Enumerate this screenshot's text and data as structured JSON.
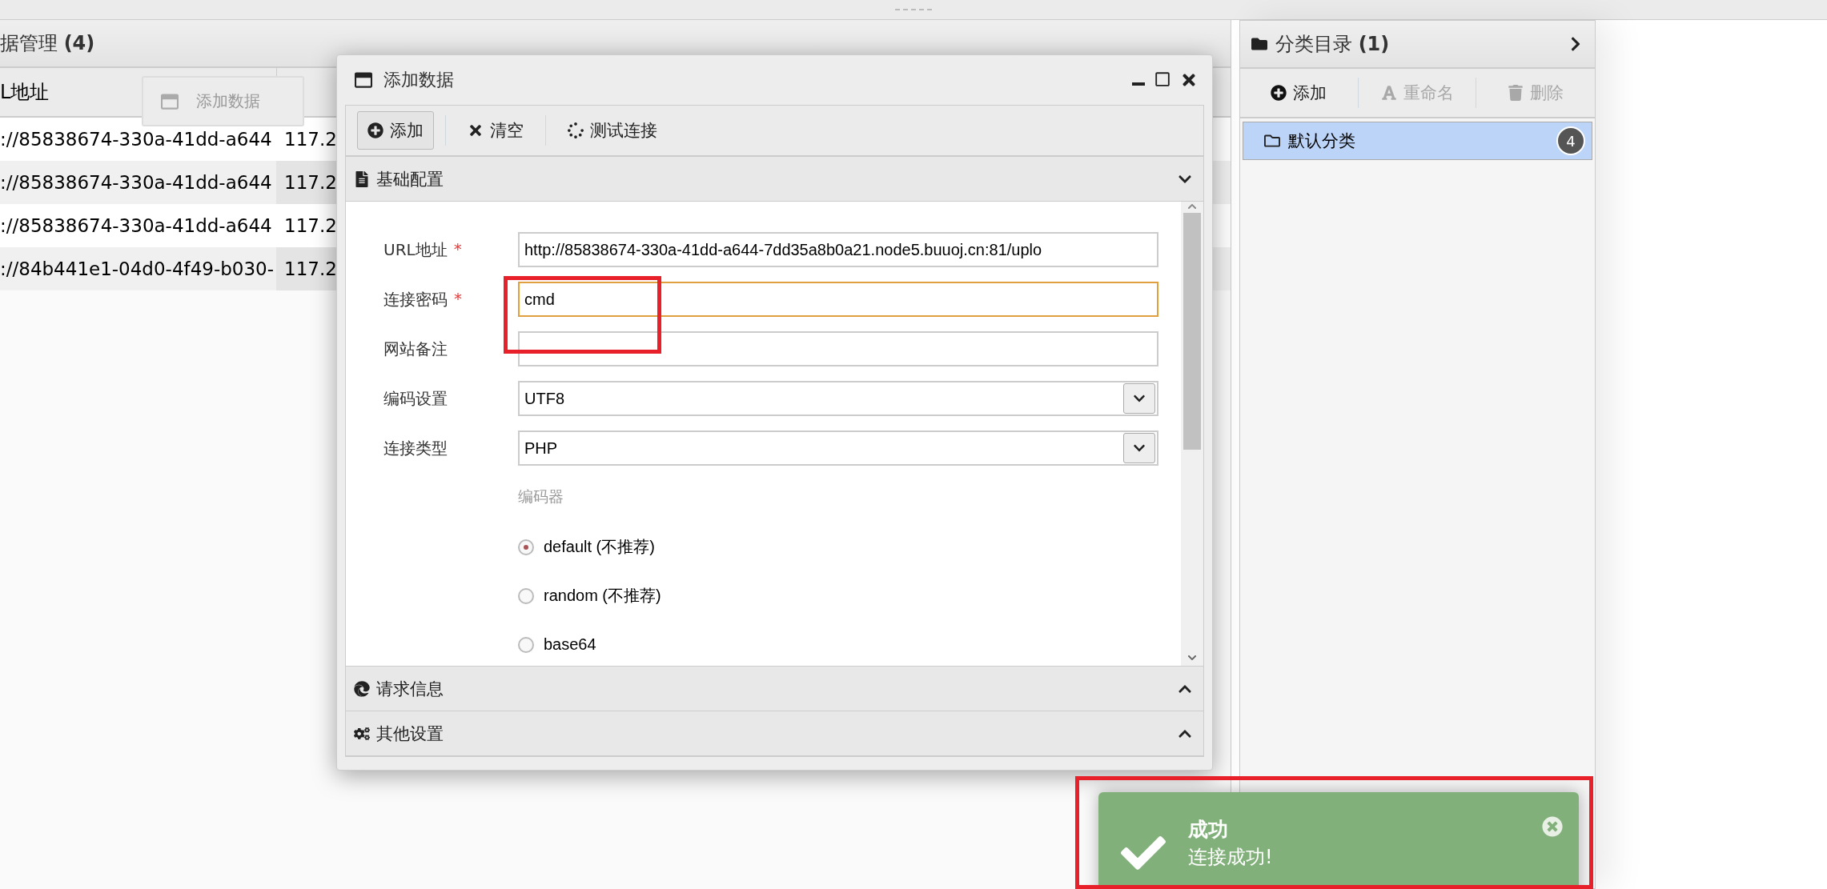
{
  "left_panel": {
    "title": "据管理 **(4)**",
    "column_1": "L地址",
    "rows": [
      {
        "url": "://85838674-330a-41dd-a644",
        "ip": "117.2"
      },
      {
        "url": "://85838674-330a-41dd-a644",
        "ip": "117.2"
      },
      {
        "url": "://85838674-330a-41dd-a644",
        "ip": "117.2"
      },
      {
        "url": "://84b441e1-04d0-4f49-b030-",
        "ip": "117.2"
      }
    ]
  },
  "drag_ghost": {
    "title": "添加数据"
  },
  "dialog": {
    "title": "添加数据",
    "toolbar": [
      {
        "kind": "add",
        "label": "添加"
      },
      {
        "kind": "clear",
        "label": "清空"
      },
      {
        "kind": "test",
        "label": "测试连接"
      }
    ],
    "sections": [
      {
        "kind": "basic",
        "title": "基础配置",
        "expanded": true
      },
      {
        "kind": "request",
        "title": "请求信息",
        "expanded": false
      },
      {
        "kind": "other",
        "title": "其他设置",
        "expanded": false
      }
    ],
    "fields": [
      {
        "kind": "text",
        "label": "URL地址",
        "required_mark": "*",
        "value": "http://85838674-330a-41dd-a644-7dd35a8b0a21.node5.buuoj.cn:81/uplo"
      },
      {
        "kind": "text",
        "label": "连接密码",
        "required_mark": "*",
        "value": "cmd",
        "focused": true
      },
      {
        "kind": "text",
        "label": "网站备注"
      },
      {
        "kind": "select",
        "label": "编码设置",
        "value": "UTF8"
      },
      {
        "kind": "select",
        "label": "连接类型",
        "value": "PHP"
      }
    ],
    "encoder": {
      "label": "编码器",
      "options": [
        {
          "label": "default (不推荐)",
          "selected": true
        },
        {
          "label": "random (不推荐)",
          "selected": false
        },
        {
          "label": "base64",
          "selected": false
        }
      ]
    }
  },
  "right_panel": {
    "title": "分类目录 **(1)**",
    "toolbar": [
      {
        "kind": "add",
        "label": "添加",
        "disabled": false
      },
      {
        "kind": "rename",
        "label": "重命名",
        "disabled": true
      },
      {
        "kind": "delete",
        "label": "删除",
        "disabled": true
      }
    ],
    "items": [
      {
        "label": "默认分类",
        "count": "4",
        "selected": true
      }
    ]
  },
  "toast": {
    "title": "成功",
    "message": "连接成功!"
  }
}
